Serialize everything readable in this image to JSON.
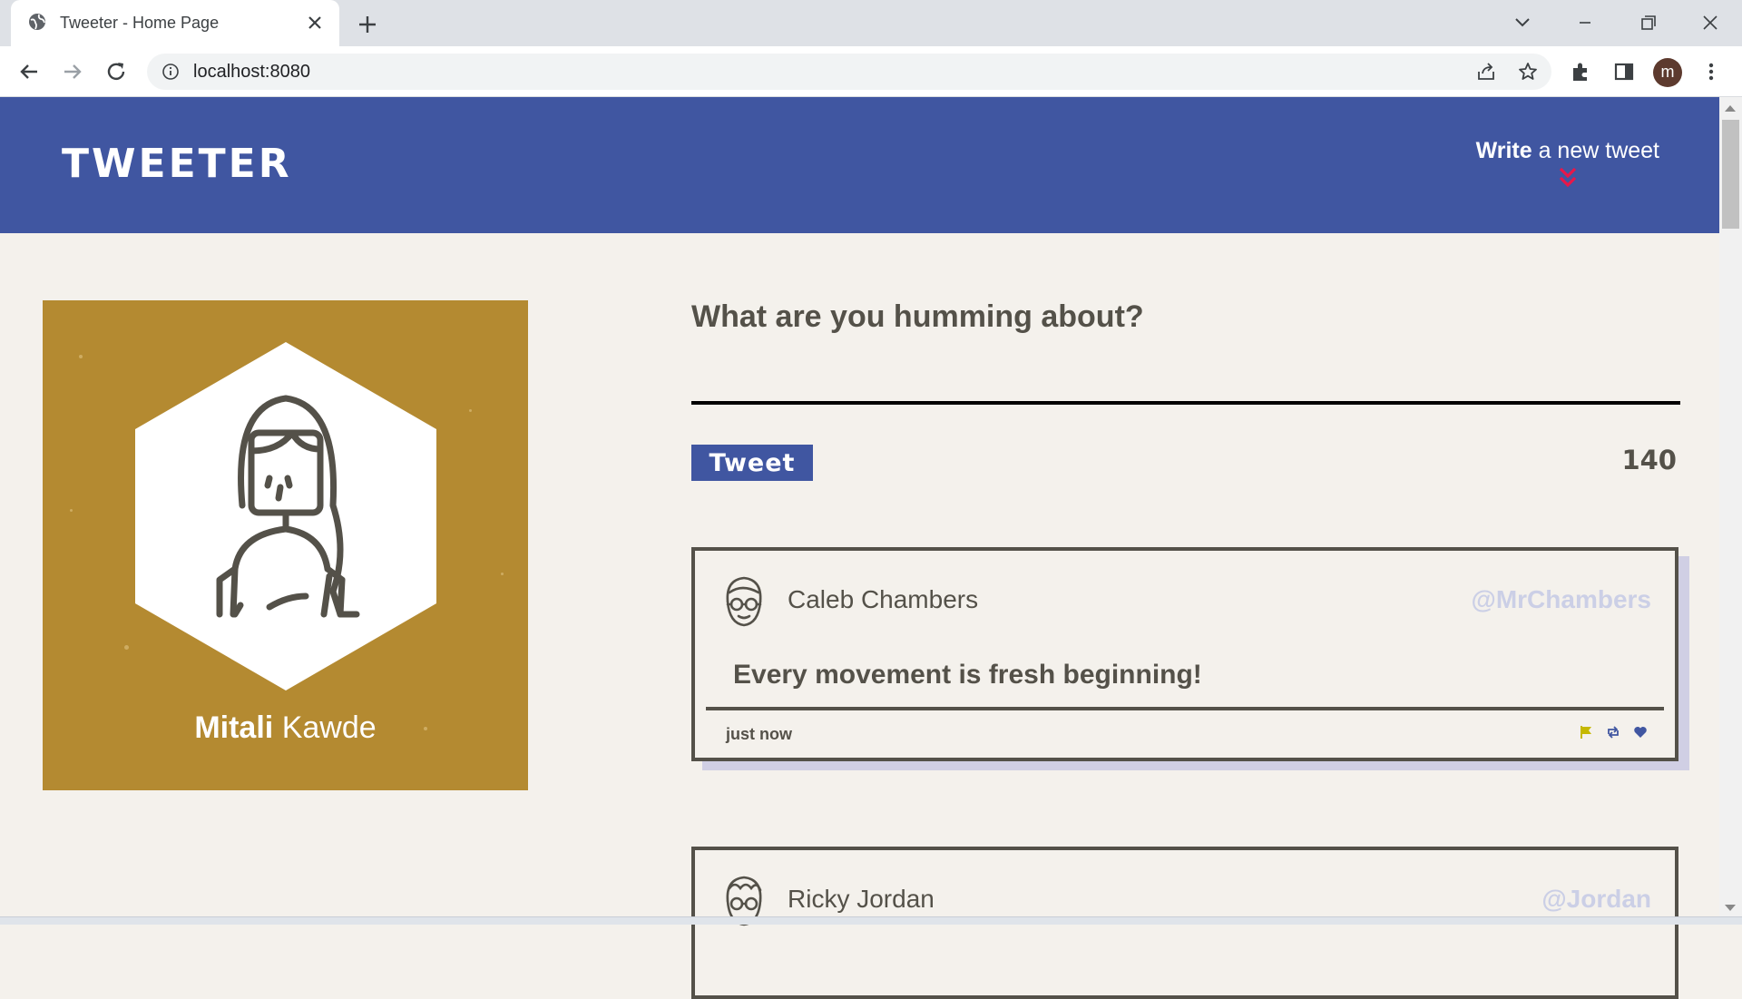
{
  "browser": {
    "tab_title": "Tweeter - Home Page",
    "url": "localhost:8080",
    "profile_initial": "m"
  },
  "header": {
    "brand": "Tweeter",
    "compose_bold": "Write",
    "compose_rest": " a new tweet"
  },
  "profile": {
    "first_name": "Mitali",
    "last_name": " Kawde"
  },
  "composer": {
    "prompt": "What are you humming about?",
    "placeholder": "",
    "button_label": "Tweet",
    "counter": "140"
  },
  "tweets": [
    {
      "name": "Caleb Chambers",
      "handle": "@MrChambers",
      "text": "Every movement is fresh beginning!",
      "time": "just now"
    },
    {
      "name": "Ricky Jordan",
      "handle": "@Jordan",
      "text": "",
      "time": ""
    }
  ],
  "colors": {
    "accent": "#4056a1",
    "profile_bg": "#b48a31",
    "page_bg": "#f4f1ec",
    "text": "#545149",
    "flag": "#c5b800",
    "heart": "#4056a1"
  }
}
